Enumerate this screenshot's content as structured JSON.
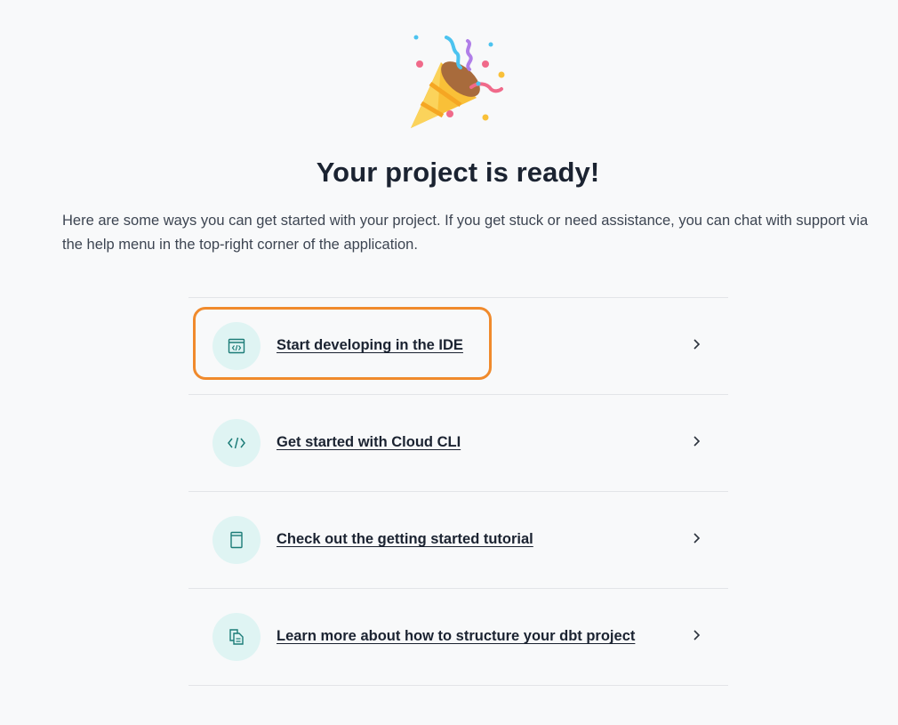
{
  "hero": {
    "icon": "party-popper-icon"
  },
  "title": "Your project is ready!",
  "intro": "Here are some ways you can get started with your project. If you get stuck or need assistance, you can chat with support via the help menu in the top-right corner of the application.",
  "options": [
    {
      "label": "Start developing in the IDE",
      "icon": "ide-window-icon"
    },
    {
      "label": "Get started with Cloud CLI",
      "icon": "code-icon"
    },
    {
      "label": "Check out the getting started tutorial",
      "icon": "book-icon"
    },
    {
      "label": "Learn more about how to structure your dbt project",
      "icon": "documents-icon"
    }
  ],
  "colors": {
    "accent_teal": "#1c7c78",
    "icon_bg": "#dff4f3",
    "highlight": "#f08a2c"
  }
}
